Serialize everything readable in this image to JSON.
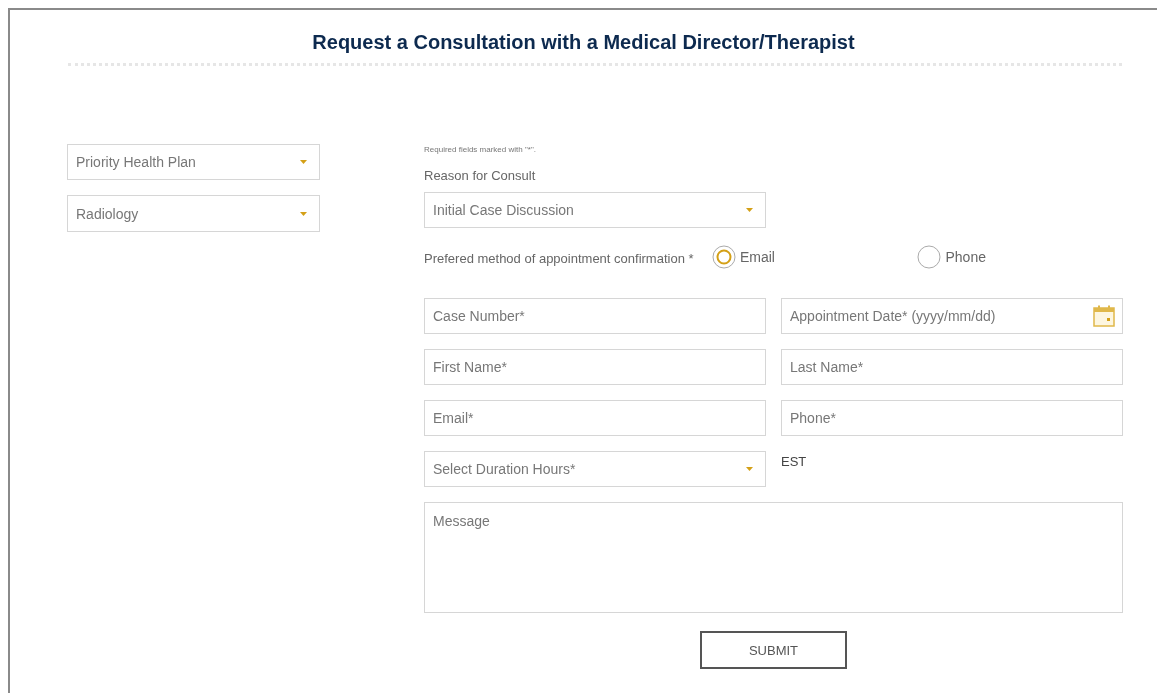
{
  "title": "Request a Consultation with a Medical Director/Therapist",
  "left_selects": [
    {
      "value": "Priority Health Plan"
    },
    {
      "value": "Radiology"
    }
  ],
  "required_note": "Required fields marked with \"*\".",
  "reason": {
    "label": "Reason for Consult",
    "value": "Initial Case Discussion"
  },
  "confirmation": {
    "label": "Prefered method of appointment confirmation *",
    "options": [
      {
        "label": "Email",
        "selected": true
      },
      {
        "label": "Phone",
        "selected": false
      }
    ]
  },
  "fields": [
    {
      "placeholder": "Case Number*"
    },
    {
      "placeholder": "Appointment Date* (yyyy/mm/dd)",
      "kind": "date"
    },
    {
      "placeholder": "First Name*"
    },
    {
      "placeholder": "Last Name*"
    },
    {
      "placeholder": "Email*"
    },
    {
      "placeholder": "Phone*"
    }
  ],
  "duration": {
    "placeholder": "Select Duration Hours*"
  },
  "timezone": "EST",
  "message": {
    "placeholder": "Message"
  },
  "submit": "SUBMIT"
}
